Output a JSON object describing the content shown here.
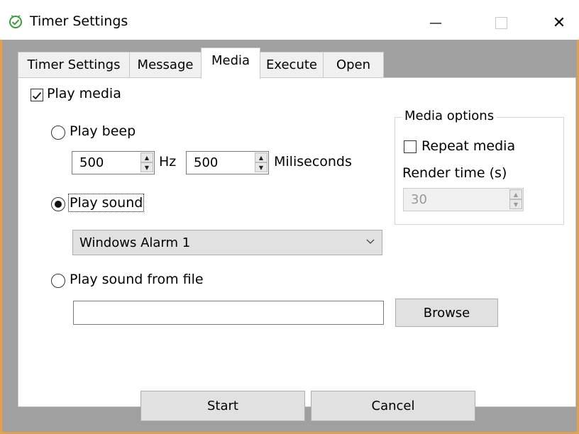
{
  "window": {
    "title": "Timer Settings",
    "minimize_glyph": "—",
    "close_glyph": "✕",
    "app_icon": "timer-check-icon"
  },
  "tabs": [
    {
      "label": "Timer Settings"
    },
    {
      "label": "Message"
    },
    {
      "label": "Media",
      "active": true
    },
    {
      "label": "Execute"
    },
    {
      "label": "Open"
    }
  ],
  "media": {
    "play_media": {
      "label": "Play media",
      "checked": true
    },
    "play_beep": {
      "label": "Play beep",
      "selected": false
    },
    "hz_value": "500",
    "hz_unit": "Hz",
    "ms_value": "500",
    "ms_unit": "Miliseconds",
    "play_sound": {
      "label": "Play sound",
      "selected": true
    },
    "sound_select": "Windows Alarm 1",
    "play_file": {
      "label": "Play sound from file",
      "selected": false
    },
    "file_path": "",
    "browse_label": "Browse"
  },
  "options": {
    "legend": "Media options",
    "repeat_label": "Repeat media",
    "repeat_checked": false,
    "render_label": "Render time (s)",
    "render_value": "30"
  },
  "footer": {
    "start_label": "Start",
    "cancel_label": "Cancel"
  },
  "colors": {
    "border_accent": "#e6a04a",
    "icon_green": "#3a9b3a",
    "background_gray": "#a0a0a0"
  }
}
